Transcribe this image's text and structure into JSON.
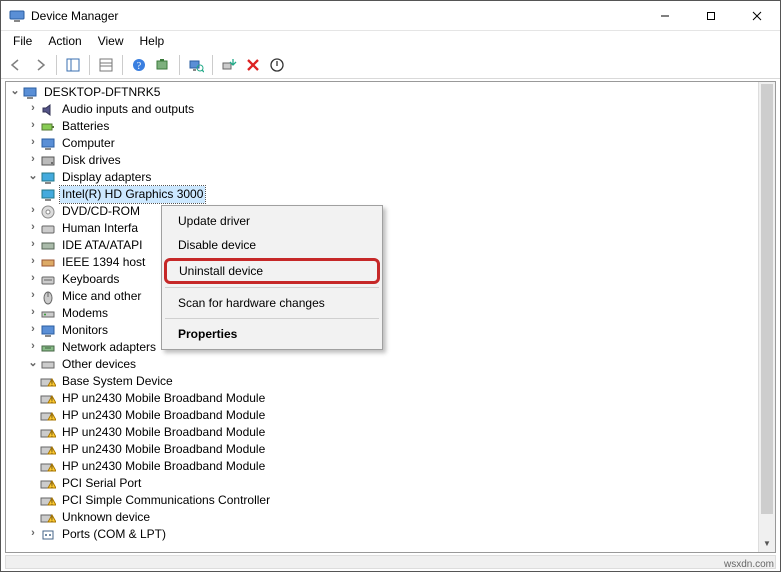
{
  "window": {
    "title": "Device Manager"
  },
  "menu": {
    "file": "File",
    "action": "Action",
    "view": "View",
    "help": "Help"
  },
  "tree": {
    "root": "DESKTOP-DFTNRK5",
    "items": {
      "audio": "Audio inputs and outputs",
      "batteries": "Batteries",
      "computer": "Computer",
      "disk": "Disk drives",
      "display": "Display adapters",
      "display_child": "Intel(R) HD Graphics 3000",
      "dvd": "DVD/CD-ROM",
      "hid": "Human Interfa",
      "ide": "IDE ATA/ATAPI",
      "ieee1394": "IEEE 1394 host",
      "keyboards": "Keyboards",
      "mice": "Mice and other",
      "modems": "Modems",
      "monitors": "Monitors",
      "network": "Network adapters",
      "other": "Other devices",
      "other_children": {
        "c0": "Base System Device",
        "c1": "HP un2430 Mobile Broadband Module",
        "c2": "HP un2430 Mobile Broadband Module",
        "c3": "HP un2430 Mobile Broadband Module",
        "c4": "HP un2430 Mobile Broadband Module",
        "c5": "HP un2430 Mobile Broadband Module",
        "c6": "PCI Serial Port",
        "c7": "PCI Simple Communications Controller",
        "c8": "Unknown device"
      },
      "ports": "Ports (COM & LPT)"
    }
  },
  "context_menu": {
    "update": "Update driver",
    "disable": "Disable device",
    "uninstall": "Uninstall device",
    "scan": "Scan for hardware changes",
    "properties": "Properties"
  },
  "watermark": "wsxdn.com"
}
